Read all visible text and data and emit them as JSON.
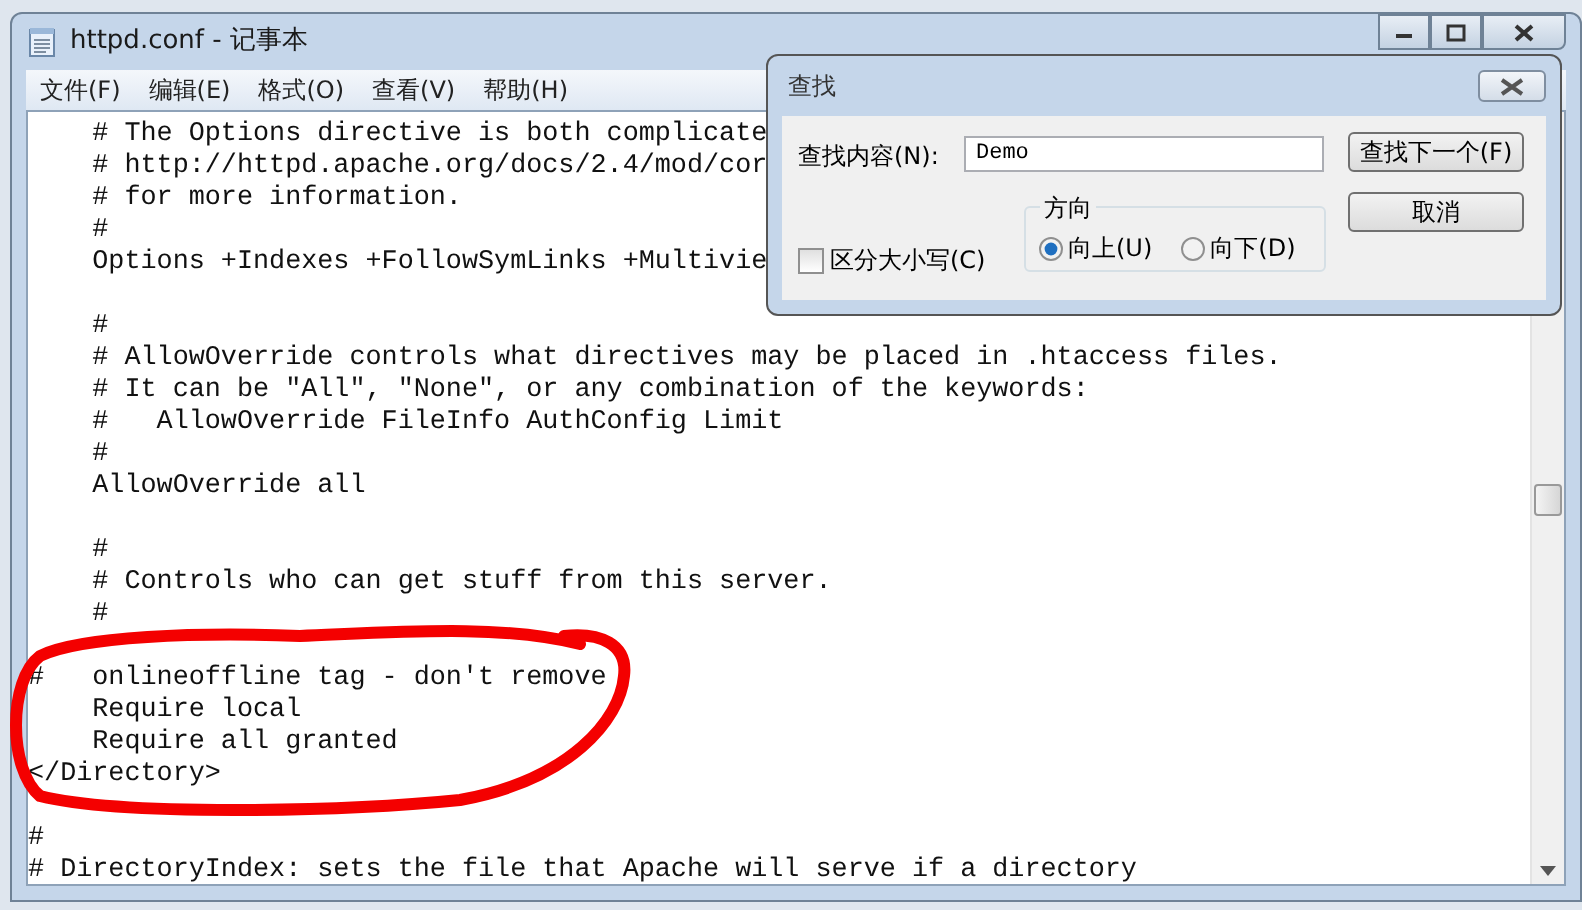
{
  "window": {
    "title": "httpd.conf - 记事本"
  },
  "menu": [
    "文件(F)",
    "编辑(E)",
    "格式(O)",
    "查看(V)",
    "帮助(H)"
  ],
  "editor": {
    "blocks": [
      [
        "    # The Options directive is both complicate",
        "    # http://httpd.apache.org/docs/2.4/mod/cor",
        "    # for more information.",
        "    #",
        "    Options +Indexes +FollowSymLinks +Multivie"
      ],
      [
        "    #",
        "    # AllowOverride controls what directives may be placed in .htaccess files.",
        "    # It can be \"All\", \"None\", or any combination of the keywords:",
        "    #   AllowOverride FileInfo AuthConfig Limit",
        "    #",
        "    AllowOverride all"
      ],
      [
        "    #",
        "    # Controls who can get stuff from this server.",
        "    #"
      ],
      [
        "#   onlineoffline tag - don't remove",
        "    Require local",
        "    Require all granted",
        "</Directory>"
      ],
      [
        "#",
        "# DirectoryIndex: sets the file that Apache will serve if a directory"
      ]
    ]
  },
  "find_dialog": {
    "title": "查找",
    "find_label": "查找内容(N):",
    "find_value": "Demo",
    "find_next": "查找下一个(F)",
    "cancel": "取消",
    "match_case": {
      "label": "区分大小写(C)",
      "checked": false
    },
    "direction": {
      "label": "方向",
      "options": [
        {
          "label": "向上(U)",
          "selected": true
        },
        {
          "label": "向下(D)",
          "selected": false
        }
      ]
    }
  }
}
